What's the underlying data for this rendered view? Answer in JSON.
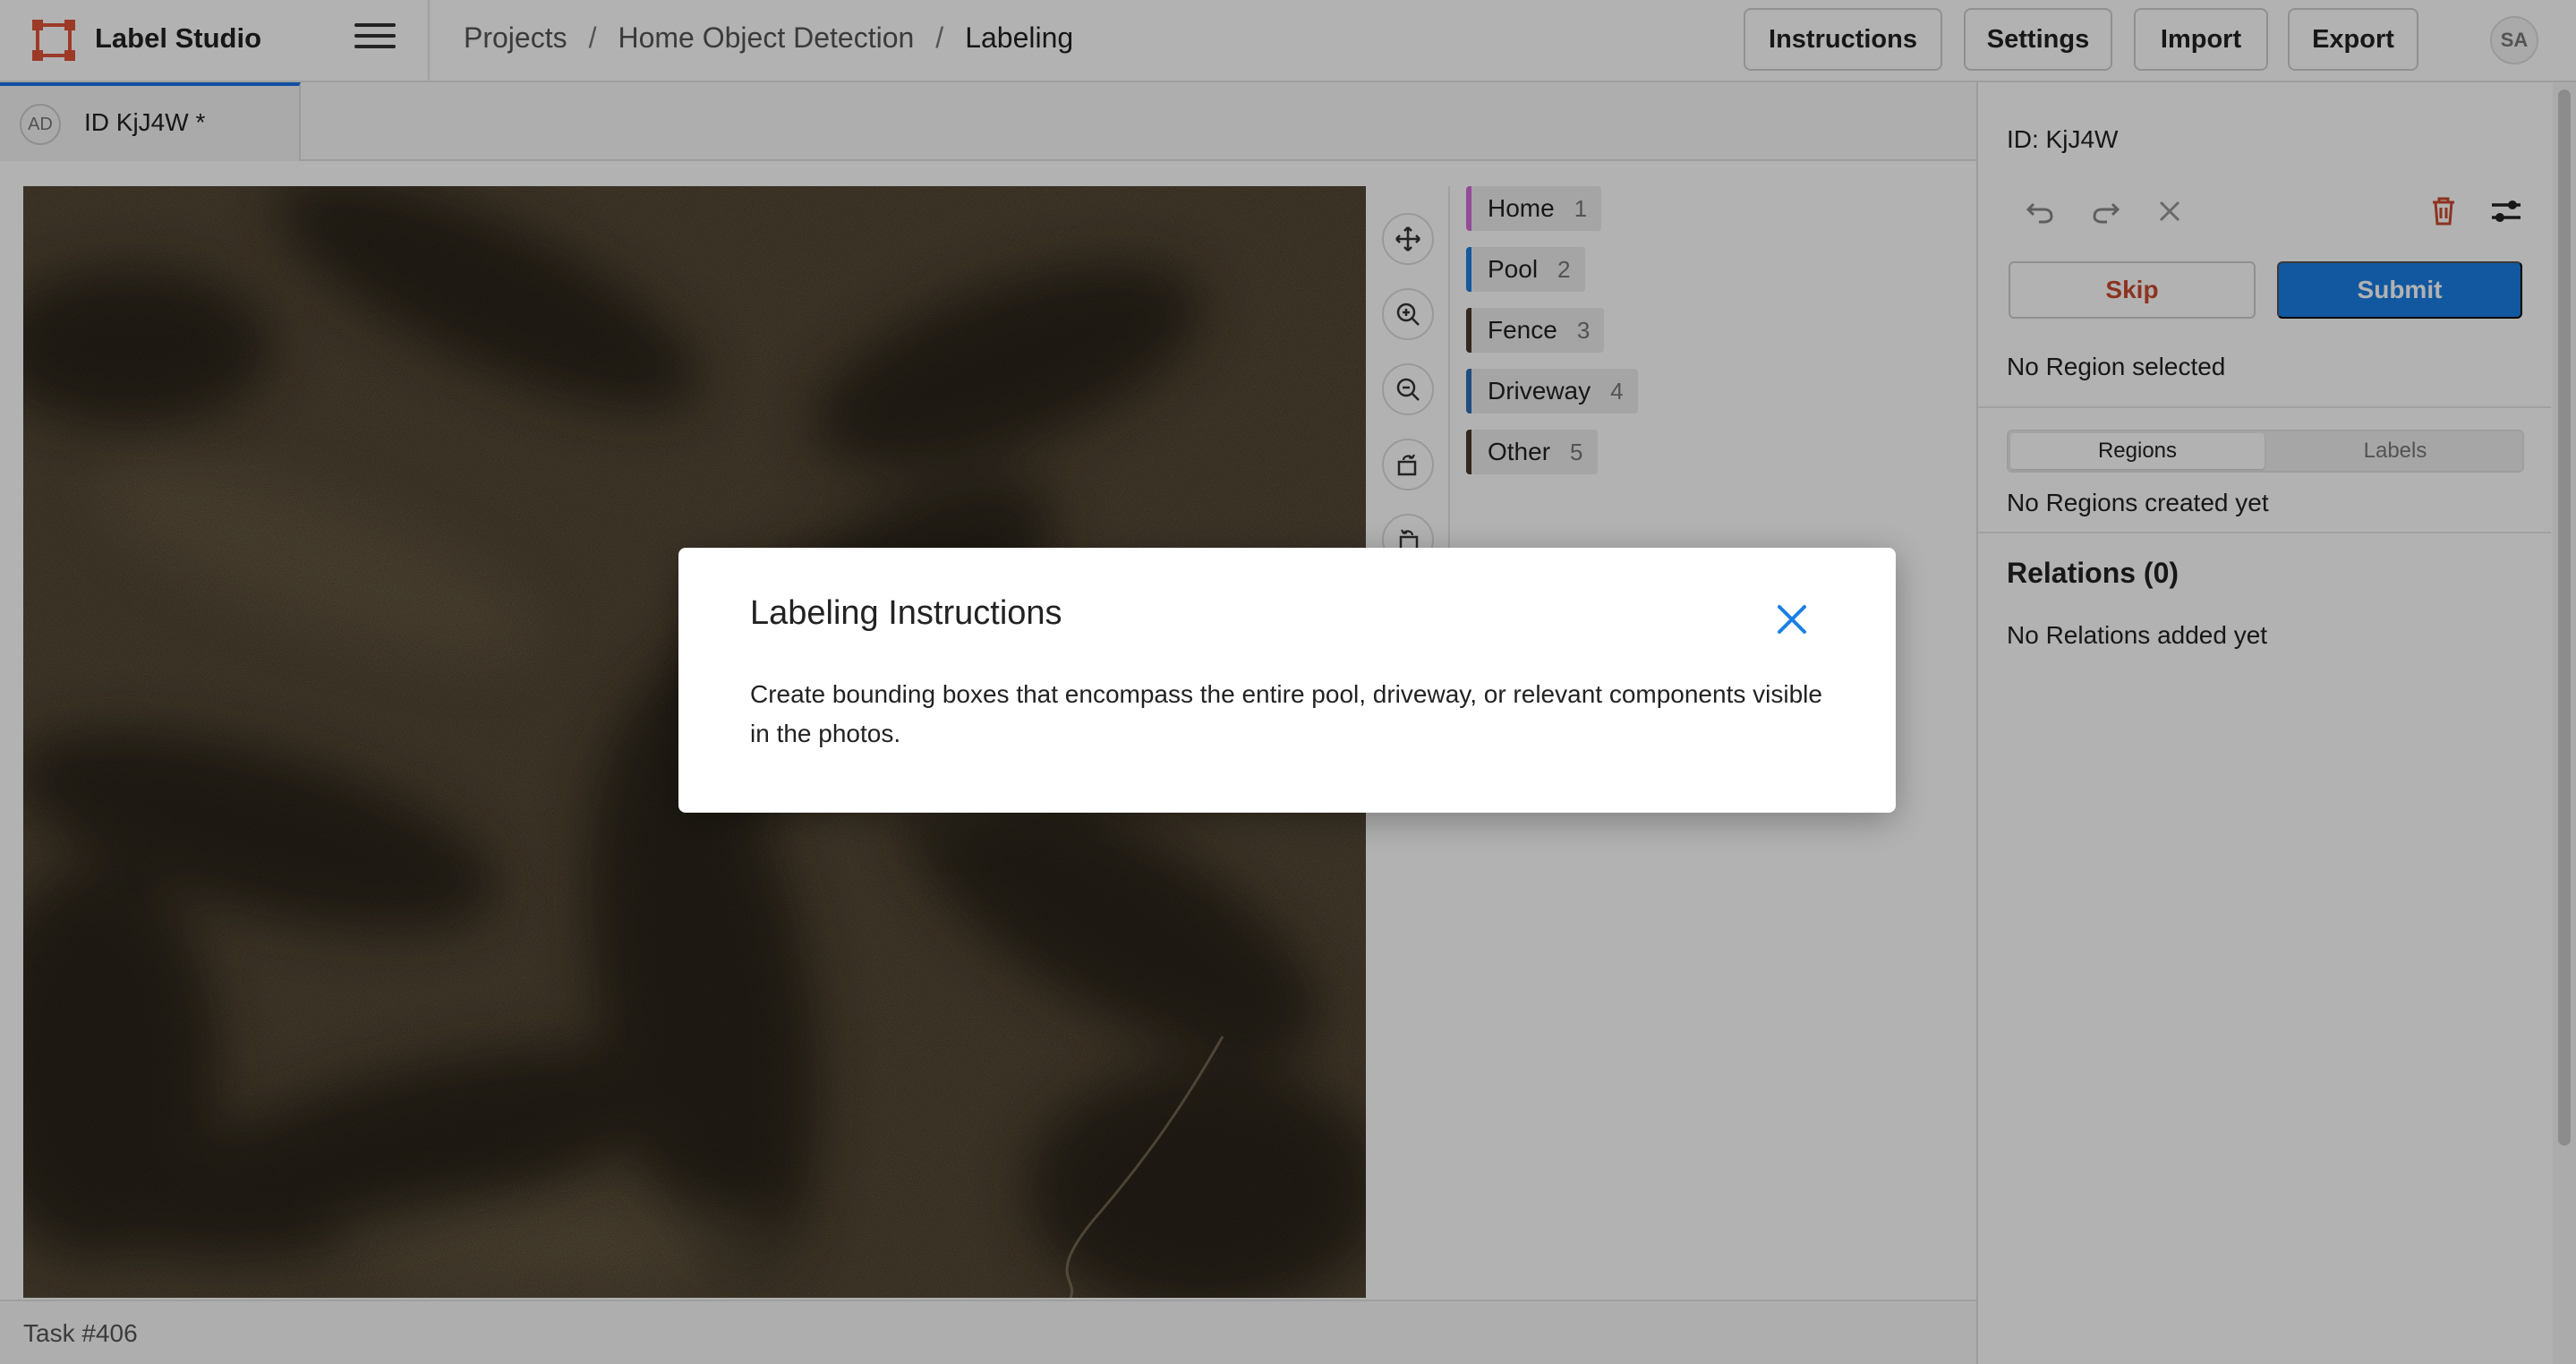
{
  "app": {
    "name": "Label Studio"
  },
  "breadcrumb": {
    "projects": "Projects",
    "separator": "/",
    "project": "Home Object Detection",
    "current": "Labeling"
  },
  "toolbar": {
    "instructions": "Instructions",
    "settings": "Settings",
    "import": "Import",
    "export": "Export"
  },
  "user": {
    "initials": "SA"
  },
  "tab": {
    "avatar": "AD",
    "label": "ID KjJ4W *"
  },
  "tools": [
    "move-tool",
    "zoom-in",
    "zoom-out",
    "rotate-left",
    "rotate-right"
  ],
  "labels": [
    {
      "name": "Home",
      "key": "1",
      "color": "#d36ad9"
    },
    {
      "name": "Pool",
      "key": "2",
      "color": "#1f7fe0"
    },
    {
      "name": "Fence",
      "key": "3",
      "color": "#4a3a2a"
    },
    {
      "name": "Driveway",
      "key": "4",
      "color": "#2f6fb5"
    },
    {
      "name": "Other",
      "key": "5",
      "color": "#4a3a2a"
    }
  ],
  "status": {
    "task": "Task #406"
  },
  "panel": {
    "id": "ID: KjJ4W",
    "skip": "Skip",
    "submit": "Submit",
    "no_region": "No Region selected",
    "tab_regions": "Regions",
    "tab_labels": "Labels",
    "no_regions": "No Regions created yet",
    "relations_title": "Relations (0)",
    "no_relations": "No Relations added yet"
  },
  "modal": {
    "title": "Labeling Instructions",
    "body": "Create bounding boxes that encompass the entire pool, driveway, or relevant components visible in the photos."
  },
  "colors": {
    "accent": "#1a7fe6",
    "danger": "#c94a2e",
    "brand": "#e0533a"
  }
}
